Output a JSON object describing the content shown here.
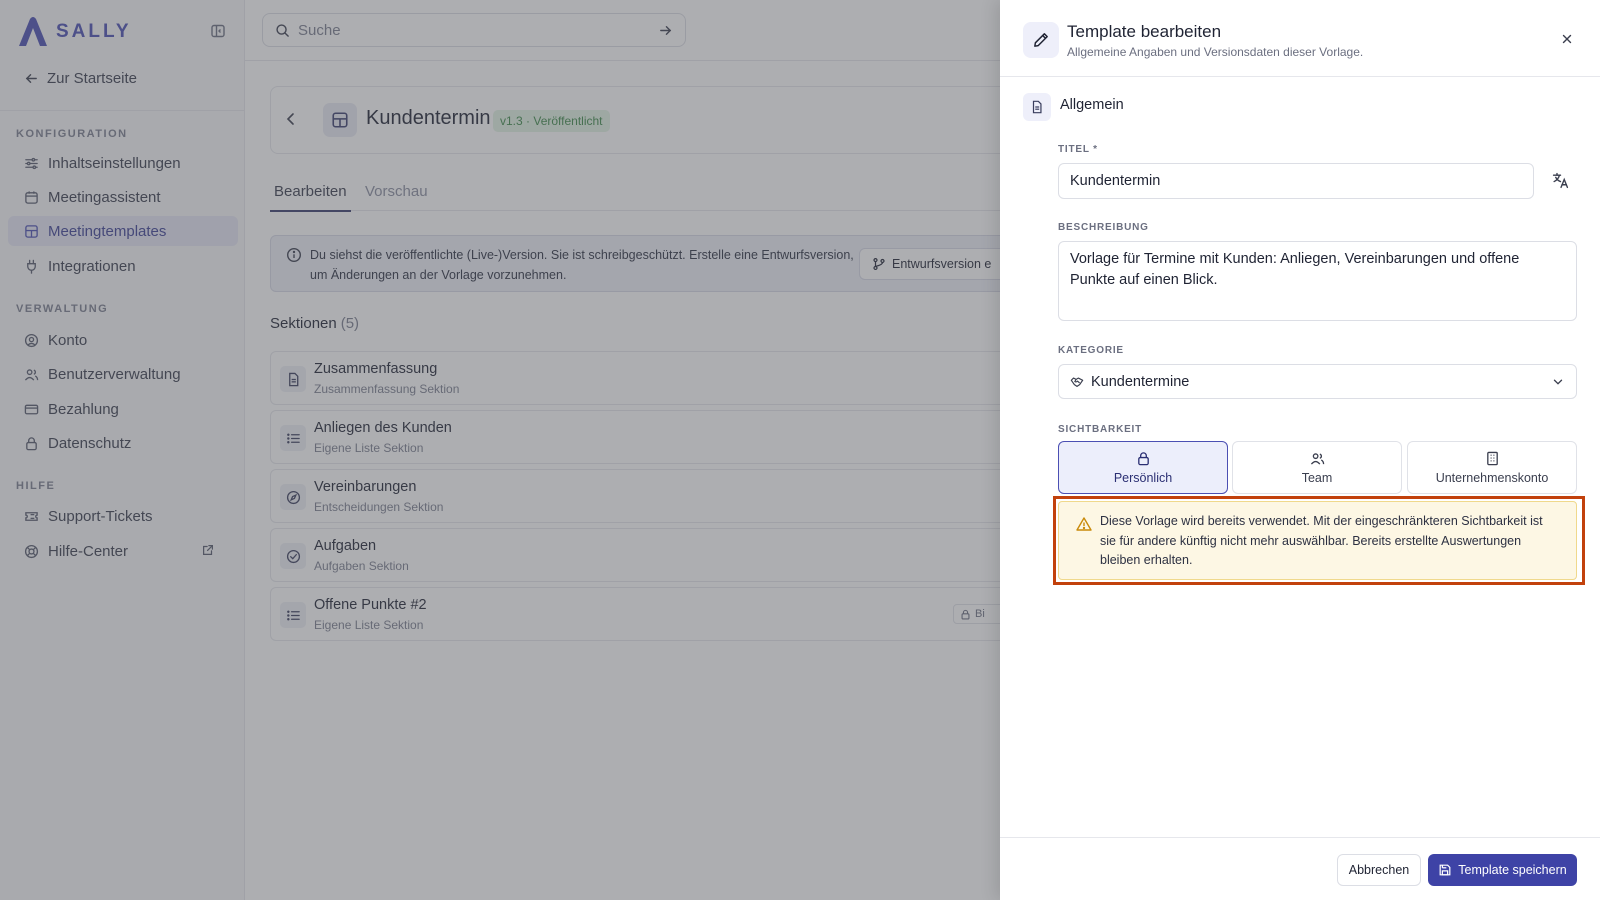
{
  "brand": {
    "name": "SALLY",
    "color": "#4b4fb3"
  },
  "sidebar": {
    "home_link": "Zur Startseite",
    "sections": [
      {
        "label": "KONFIGURATION",
        "items": [
          {
            "label": "Inhaltseinstellungen",
            "icon": "sliders-icon"
          },
          {
            "label": "Meetingassistent",
            "icon": "calendar-icon"
          },
          {
            "label": "Meetingtemplates",
            "icon": "template-icon",
            "active": true
          },
          {
            "label": "Integrationen",
            "icon": "plug-icon"
          }
        ]
      },
      {
        "label": "VERWALTUNG",
        "items": [
          {
            "label": "Konto",
            "icon": "user-circle-icon"
          },
          {
            "label": "Benutzerverwaltung",
            "icon": "users-icon"
          },
          {
            "label": "Bezahlung",
            "icon": "credit-card-icon"
          },
          {
            "label": "Datenschutz",
            "icon": "lock-icon"
          }
        ]
      },
      {
        "label": "HILFE",
        "items": [
          {
            "label": "Support-Tickets",
            "icon": "ticket-icon"
          },
          {
            "label": "Hilfe-Center",
            "icon": "lifebuoy-icon",
            "external": true
          }
        ]
      }
    ]
  },
  "search": {
    "placeholder": "Suche"
  },
  "page": {
    "title": "Kundentermin",
    "version_badge": "v1.3 · Veröffentlicht",
    "tabs": [
      "Bearbeiten",
      "Vorschau"
    ],
    "active_tab": "Bearbeiten",
    "info_text": "Du siehst die veröffentlichte (Live-)Version. Sie ist schreibgeschützt. Erstelle eine Entwurfsversion, um Änderungen an der Vorlage vorzunehmen.",
    "draft_button": "Entwurfsversion e",
    "sections_label": "Sektionen",
    "sections_count": "(5)",
    "sections": [
      {
        "title": "Zusammenfassung",
        "subtitle": "Zusammenfassung Sektion",
        "icon": "document-icon"
      },
      {
        "title": "Anliegen des Kunden",
        "subtitle": "Eigene Liste Sektion",
        "icon": "list-icon"
      },
      {
        "title": "Vereinbarungen",
        "subtitle": "Entscheidungen Sektion",
        "icon": "compass-icon"
      },
      {
        "title": "Aufgaben",
        "subtitle": "Aufgaben Sektion",
        "icon": "check-circle-icon"
      },
      {
        "title": "Offene Punkte #2",
        "subtitle": "Eigene Liste Sektion",
        "icon": "list-icon",
        "badge": "Bi"
      }
    ]
  },
  "drawer": {
    "title": "Template bearbeiten",
    "subtitle": "Allgemeine Angaben und Versionsdaten dieser Vorlage.",
    "section_label": "Allgemein",
    "fields": {
      "title_label": "TITEL *",
      "title_value": "Kundentermin",
      "description_label": "BESCHREIBUNG",
      "description_value": "Vorlage für Termine mit Kunden: Anliegen, Vereinbarungen und offene Punkte auf einen Blick.",
      "category_label": "KATEGORIE",
      "category_value": "Kundentermine",
      "visibility_label": "SICHTBARKEIT",
      "visibility_options": [
        "Persönlich",
        "Team",
        "Unternehmenskonto"
      ],
      "visibility_selected": "Persönlich"
    },
    "warning": "Diese Vorlage wird bereits verwendet. Mit der eingeschränkteren Sichtbarkeit ist sie für andere künftig nicht mehr auswählbar. Bereits erstellte Auswertungen bleiben erhalten.",
    "cancel_label": "Abbrechen",
    "save_label": "Template speichern"
  },
  "colors": {
    "accent": "#3e43a6",
    "warning_bg": "#fdf7e4",
    "highlight_outline": "#c2410c",
    "published": "#3f8a4b"
  }
}
